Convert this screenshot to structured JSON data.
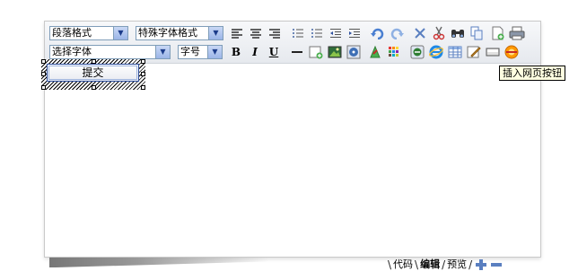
{
  "toolbar": {
    "row1": {
      "paragraph_select": "段落格式",
      "special_font_select": "特殊字体格式"
    },
    "row2": {
      "font_select": "选择字体",
      "size_select": "字号",
      "bold": "B",
      "italic": "I",
      "underline": "U"
    },
    "icons_row1": [
      "align-left-icon",
      "align-center-icon",
      "align-right-icon",
      "unordered-list-icon",
      "ordered-list-icon",
      "outdent-icon",
      "indent-icon",
      "undo-icon",
      "redo-icon",
      "cut-icon",
      "copy-icon",
      "find-icon",
      "paste-icon",
      "new-page-icon",
      "print-icon"
    ],
    "icons_row2": [
      "horizontal-rule-icon",
      "insert-layer-icon",
      "insert-image-icon",
      "insert-media-icon",
      "insert-flash-icon",
      "color-palette-icon",
      "insert-link-icon",
      "internet-explorer-icon",
      "insert-table-icon",
      "insert-textarea-icon",
      "insert-input-icon",
      "insert-button-icon"
    ]
  },
  "editor": {
    "submit_button": "提交"
  },
  "tooltip": "插入网页按钮",
  "tabs": {
    "code": "代码",
    "edit": "编辑",
    "preview": "预览"
  },
  "colors": {
    "accent": "#2d4f9e",
    "toolbar_bg": "#e6e9ee",
    "tooltip_bg": "#ffffe1"
  }
}
